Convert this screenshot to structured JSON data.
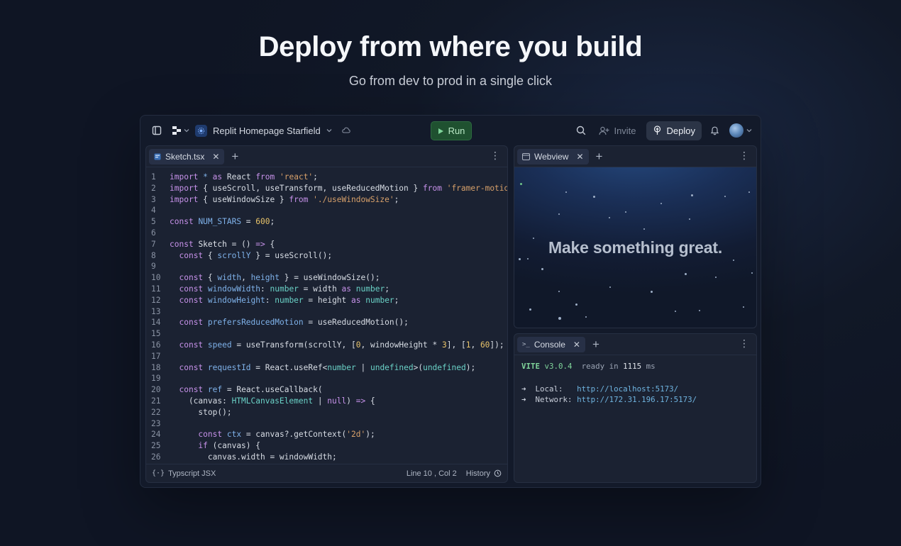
{
  "hero": {
    "title": "Deploy from where you build",
    "subtitle": "Go from dev to prod in a single click"
  },
  "topbar": {
    "project_name": "Replit Homepage Starfield",
    "run_label": "Run",
    "invite_label": "Invite",
    "deploy_label": "Deploy"
  },
  "editor": {
    "tab_label": "Sketch.tsx",
    "language": "Typscript JSX",
    "cursor": "Line 10 , Col 2",
    "history_label": "History",
    "lines": [
      {
        "n": "1",
        "html": "<span class='kw'>import</span> <span class='id'>*</span> <span class='kw'>as</span> React <span class='kw'>from</span> <span class='str'>'react'</span>;"
      },
      {
        "n": "2",
        "html": "<span class='kw'>import</span> { useScroll, useTransform, useReducedMotion } <span class='kw'>from</span> <span class='str'>'framer-motion'</span>;"
      },
      {
        "n": "3",
        "html": "<span class='kw'>import</span> { useWindowSize } <span class='kw'>from</span> <span class='str'>'./useWindowSize'</span>;"
      },
      {
        "n": "4",
        "html": ""
      },
      {
        "n": "5",
        "html": "<span class='kw'>const</span> <span class='id'>NUM_STARS</span> = <span class='num'>600</span>;"
      },
      {
        "n": "6",
        "html": ""
      },
      {
        "n": "7",
        "html": "<span class='kw'>const</span> <span class='fn'>Sketch</span> = () <span class='kw'>=&gt;</span> {"
      },
      {
        "n": "8",
        "html": "  <span class='kw'>const</span> { <span class='id'>scrollY</span> } = useScroll();"
      },
      {
        "n": "9",
        "html": ""
      },
      {
        "n": "10",
        "html": "  <span class='kw'>const</span> { <span class='id'>width</span>, <span class='id'>height</span> } = useWindowSize();"
      },
      {
        "n": "11",
        "html": "  <span class='kw'>const</span> <span class='id'>windowWidth</span>: <span class='ty'>number</span> = width <span class='kw'>as</span> <span class='ty'>number</span>;"
      },
      {
        "n": "12",
        "html": "  <span class='kw'>const</span> <span class='id'>windowHeight</span>: <span class='ty'>number</span> = height <span class='kw'>as</span> <span class='ty'>number</span>;"
      },
      {
        "n": "13",
        "html": ""
      },
      {
        "n": "14",
        "html": "  <span class='kw'>const</span> <span class='id'>prefersReducedMotion</span> = useReducedMotion();"
      },
      {
        "n": "15",
        "html": ""
      },
      {
        "n": "16",
        "html": "  <span class='kw'>const</span> <span class='id'>speed</span> = useTransform(scrollY, [<span class='num'>0</span>, windowHeight * <span class='num'>3</span>], [<span class='num'>1</span>, <span class='num'>60</span>]);"
      },
      {
        "n": "17",
        "html": ""
      },
      {
        "n": "18",
        "html": "  <span class='kw'>const</span> <span class='id'>requestId</span> = React.useRef&lt;<span class='ty'>number</span> | <span class='ty'>undefined</span>&gt;(<span class='ty'>undefined</span>);"
      },
      {
        "n": "19",
        "html": ""
      },
      {
        "n": "20",
        "html": "  <span class='kw'>const</span> <span class='id'>ref</span> = React.useCallback("
      },
      {
        "n": "21",
        "html": "    (canvas: <span class='ty'>HTMLCanvasElement</span> | <span class='kw'>null</span>) <span class='kw'>=&gt;</span> {"
      },
      {
        "n": "22",
        "html": "      stop();"
      },
      {
        "n": "23",
        "html": ""
      },
      {
        "n": "24",
        "html": "      <span class='kw'>const</span> <span class='id'>ctx</span> = canvas?.getContext(<span class='str'>'2d'</span>);"
      },
      {
        "n": "25",
        "html": "      <span class='kw'>if</span> (canvas) {"
      },
      {
        "n": "26",
        "html": "        canvas.width = windowWidth;"
      }
    ]
  },
  "webview": {
    "tab_label": "Webview",
    "headline": "Make something great."
  },
  "console": {
    "tab_label": "Console",
    "vite_name": "VITE",
    "vite_version": "v3.0.4",
    "ready_text": "ready in",
    "ready_ms": "1115",
    "ready_unit": "ms",
    "local_label": "Local:",
    "local_url": "http://localhost:5173/",
    "network_label": "Network:",
    "network_url": "http://172.31.196.17:5173/"
  }
}
